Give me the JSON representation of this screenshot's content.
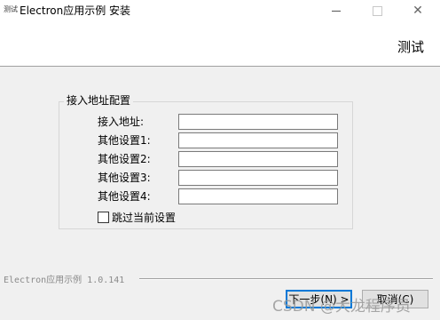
{
  "window": {
    "icon_text": "测试",
    "title": "Electron应用示例 安装",
    "minimize_glyph": "—",
    "close_glyph": "✕"
  },
  "header": {
    "title": "测试"
  },
  "group": {
    "legend": "接入地址配置",
    "fields": [
      {
        "label": "接入地址:",
        "value": ""
      },
      {
        "label": "其他设置1:",
        "value": ""
      },
      {
        "label": "其他设置2:",
        "value": ""
      },
      {
        "label": "其他设置3:",
        "value": ""
      },
      {
        "label": "其他设置4:",
        "value": ""
      }
    ],
    "checkbox": {
      "label": "跳过当前设置",
      "checked": false
    }
  },
  "footer": {
    "version": "Electron应用示例 1.0.141",
    "next_label": "下一步(N) >",
    "cancel_label": "取消(C)"
  },
  "watermark": "CSDN @大龙程序员"
}
